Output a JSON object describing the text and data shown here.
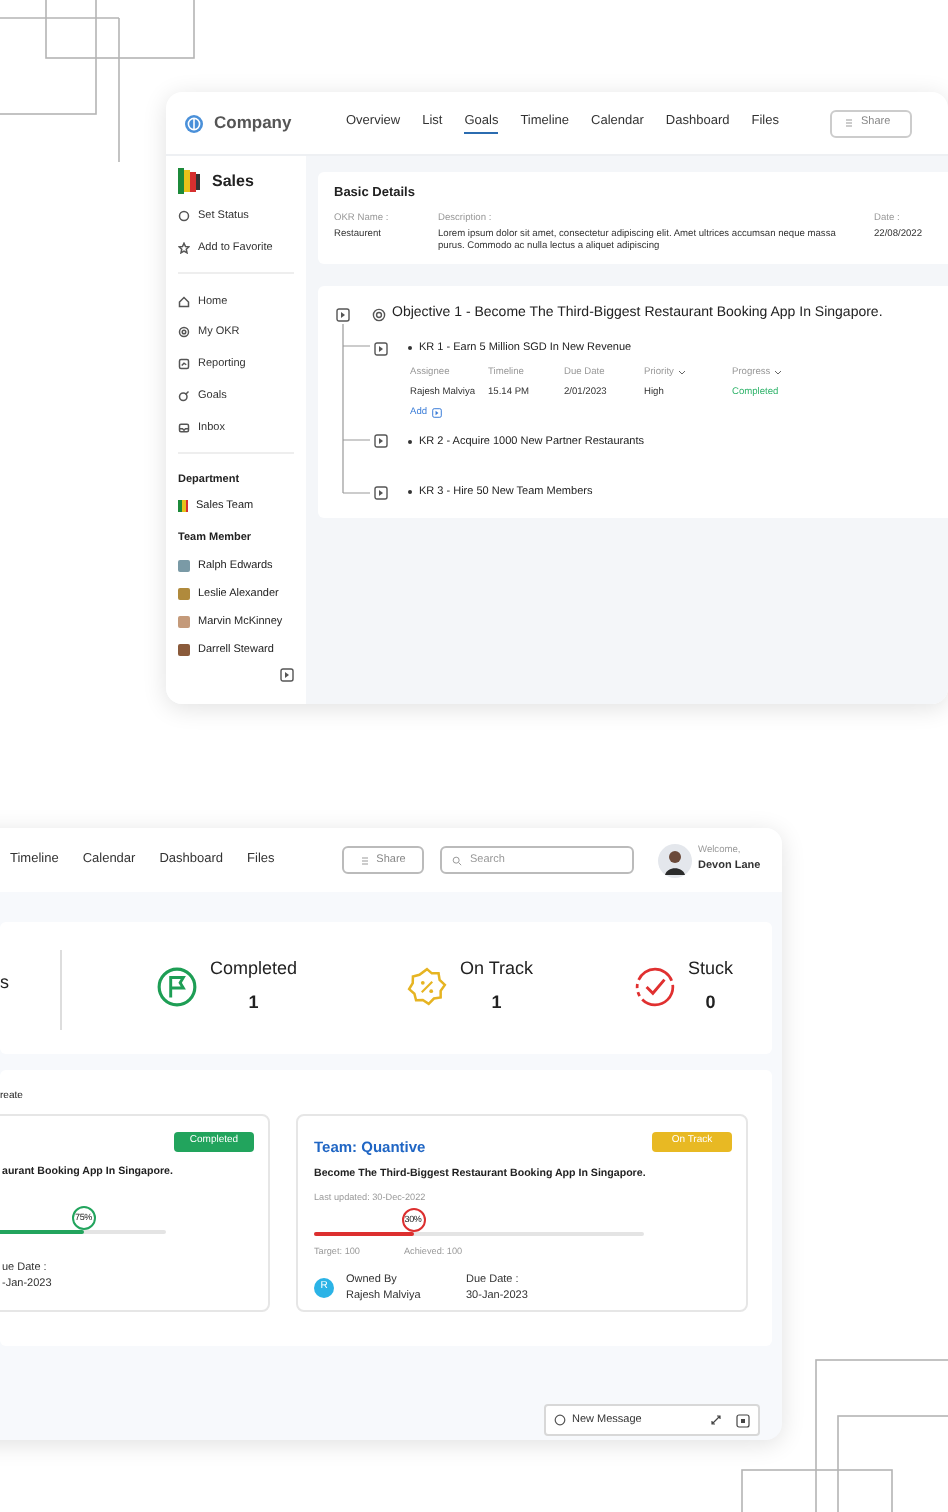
{
  "goals_window": {
    "brand": "Company",
    "nav": [
      {
        "label": "Overview",
        "selected": false
      },
      {
        "label": "List",
        "selected": false
      },
      {
        "label": "Goals",
        "selected": true
      },
      {
        "label": "Timeline",
        "selected": false
      },
      {
        "label": "Calendar",
        "selected": false
      },
      {
        "label": "Dashboard",
        "selected": false
      },
      {
        "label": "Files",
        "selected": false
      }
    ],
    "share_button": "Share",
    "sidebar": {
      "title": "Sales",
      "actions": [
        {
          "label": "Set Status",
          "kind": "status"
        },
        {
          "label": "Add to Favorite",
          "kind": "favorite"
        }
      ],
      "items": [
        {
          "label": "Home",
          "kind": "home"
        },
        {
          "label": "My OKR",
          "kind": "okr"
        },
        {
          "label": "Reporting",
          "kind": "reporting"
        },
        {
          "label": "Goals",
          "kind": "goals"
        },
        {
          "label": "Inbox",
          "kind": "inbox"
        }
      ],
      "department_heading": "Department",
      "departments": [
        "Sales Team"
      ],
      "team_heading": "Team Member",
      "members": [
        {
          "name": "Ralph Edwards",
          "color": "#7a9aa6"
        },
        {
          "name": "Leslie Alexander",
          "color": "#b08a3c"
        },
        {
          "name": "Marvin McKinney",
          "color": "#c49a7a"
        },
        {
          "name": "Darrell Steward",
          "color": "#8a5a3a"
        }
      ]
    },
    "basic_details": {
      "title": "Basic Details",
      "fields": [
        {
          "label": "OKR Name :",
          "value": "Restaurent"
        },
        {
          "label": "Description :",
          "value": "Lorem ipsum dolor sit amet, consectetur adipiscing elit. Amet ultrices accumsan neque massa purus. Commodo ac nulla lectus a aliquet adipiscing"
        },
        {
          "label": "Date :",
          "value": "22/08/2022"
        }
      ]
    },
    "objective": {
      "title": "Objective 1 - Become The Third-Biggest Restaurant Booking App In Singapore.",
      "key_results": [
        {
          "title": "KR 1 - Earn 5 Million SGD In New Revenue",
          "columns": [
            "Assignee",
            "Timeline",
            "Due Date",
            "Priority",
            "Progress"
          ],
          "row": [
            "Rajesh Malviya",
            "15.14 PM",
            "2/01/2023",
            "High",
            "Completed"
          ],
          "add": "Add"
        },
        {
          "title": "KR 2 - Acquire 1000 New Partner Restaurants"
        },
        {
          "title": "KR 3 - Hire 50 New Team Members"
        }
      ]
    }
  },
  "dashboard_window": {
    "nav": [
      "Timeline",
      "Calendar",
      "Dashboard",
      "Files"
    ],
    "share_button": "Share",
    "search": {
      "placeholder": "Search"
    },
    "user": {
      "greeting": "Welcome,",
      "name": "Devon Lane"
    },
    "stats_cut_label": "s",
    "stats": [
      {
        "label": "Completed",
        "value": "1",
        "kind": "completed"
      },
      {
        "label": "On Track",
        "value": "1",
        "kind": "on_track"
      },
      {
        "label": "Stuck",
        "value": "0",
        "kind": "stuck"
      }
    ],
    "section_cut_label": "reate",
    "cards": [
      {
        "title": "aurant Booking App In Singapore.",
        "status": "Completed",
        "color": "#22a45d",
        "progress": {
          "level": 0.75,
          "percent": "75%",
          "color": "#22a45d"
        },
        "due_label": "ue Date :",
        "due": "-Jan-2023"
      },
      {
        "team": "Team: Quantive",
        "title": "Become The Third-Biggest Restaurant Booking App In Singapore.",
        "updated": "Last updated: 30-Dec-2022",
        "status": "On Track",
        "color": "#e8b923",
        "progress": {
          "level": 0.3,
          "percent": "30%",
          "color": "#dc2f2f"
        },
        "target": "Target: 100",
        "achieved": "Achieved: 100",
        "avatar": "R",
        "owner_label": "Owned By",
        "owner": "Rajesh Malviya",
        "due_label": "Due Date :",
        "due": "30-Jan-2023"
      }
    ],
    "message_bar": "New Message"
  }
}
